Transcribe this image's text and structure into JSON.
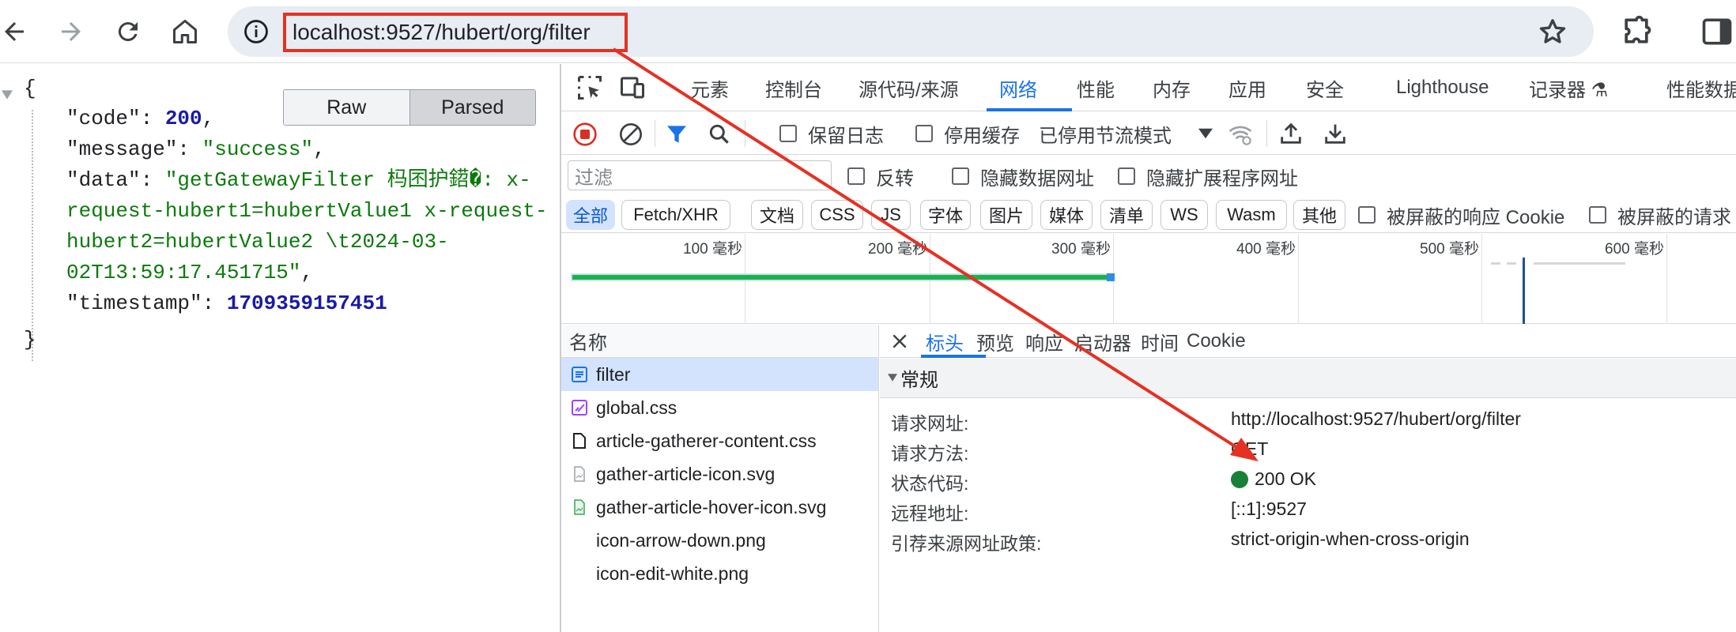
{
  "browser": {
    "url": "localhost:9527/hubert/org/filter"
  },
  "json_view": {
    "open_brace": "{",
    "close_brace": "}",
    "code_key": "\"code\": ",
    "code_val": "200",
    "message_key": "\"message\": ",
    "message_val": "\"success\"",
    "data_key": "\"data\": ",
    "data_line1": "\"getGatewayFilter 杩囨护鍣�: x-",
    "data_line2": "request-hubert1=hubertValue1 x-request-",
    "data_line3": "hubert2=hubertValue2 \\t2024-03-",
    "data_line4": "02T13:59:17.451715\"",
    "timestamp_key": "\"timestamp\": ",
    "timestamp_val": "1709359157451",
    "comma": ",",
    "raw_label": "Raw",
    "parsed_label": "Parsed"
  },
  "devtools": {
    "tabs": [
      "元素",
      "控制台",
      "源代码/来源",
      "网络",
      "性能",
      "内存",
      "应用",
      "安全",
      "Lighthouse",
      "记录器 ⚗",
      "性能数据"
    ],
    "toolbar": {
      "preserve_log": "保留日志",
      "disable_cache": "停用缓存",
      "throttle": "已停用节流模式"
    },
    "filter": {
      "placeholder": "过滤",
      "invert": "反转",
      "hide_data_urls": "隐藏数据网址",
      "hide_ext_urls": "隐藏扩展程序网址"
    },
    "types": [
      "全部",
      "Fetch/XHR",
      "文档",
      "CSS",
      "JS",
      "字体",
      "图片",
      "媒体",
      "清单",
      "WS",
      "Wasm",
      "其他"
    ],
    "blocked_cookies": "被屏蔽的响应 Cookie",
    "blocked_requests": "被屏蔽的请求",
    "overview_ticks": [
      "100 毫秒",
      "200 毫秒",
      "300 毫秒",
      "400 毫秒",
      "500 毫秒",
      "600 毫秒"
    ],
    "name_header": "名称",
    "requests": [
      "filter",
      "global.css",
      "article-gatherer-content.css",
      "gather-article-icon.svg",
      "gather-article-hover-icon.svg",
      "icon-arrow-down.png",
      "icon-edit-white.png"
    ],
    "detail_tabs": [
      "标头",
      "预览",
      "响应",
      "启动器",
      "时间",
      "Cookie"
    ],
    "general_section": "常规",
    "general": {
      "url_key": "请求网址:",
      "url_val": "http://localhost:9527/hubert/org/filter",
      "method_key": "请求方法:",
      "method_val": "GET",
      "status_key": "状态代码:",
      "status_val": "200 OK",
      "remote_key": "远程地址:",
      "remote_val": "[::1]:9527",
      "referrer_key": "引荐来源网址政策:",
      "referrer_val": "strict-origin-when-cross-origin"
    }
  },
  "colors": {
    "accent": "#1a73e8",
    "annotation_red": "#e53123",
    "status_green": "#188038"
  }
}
